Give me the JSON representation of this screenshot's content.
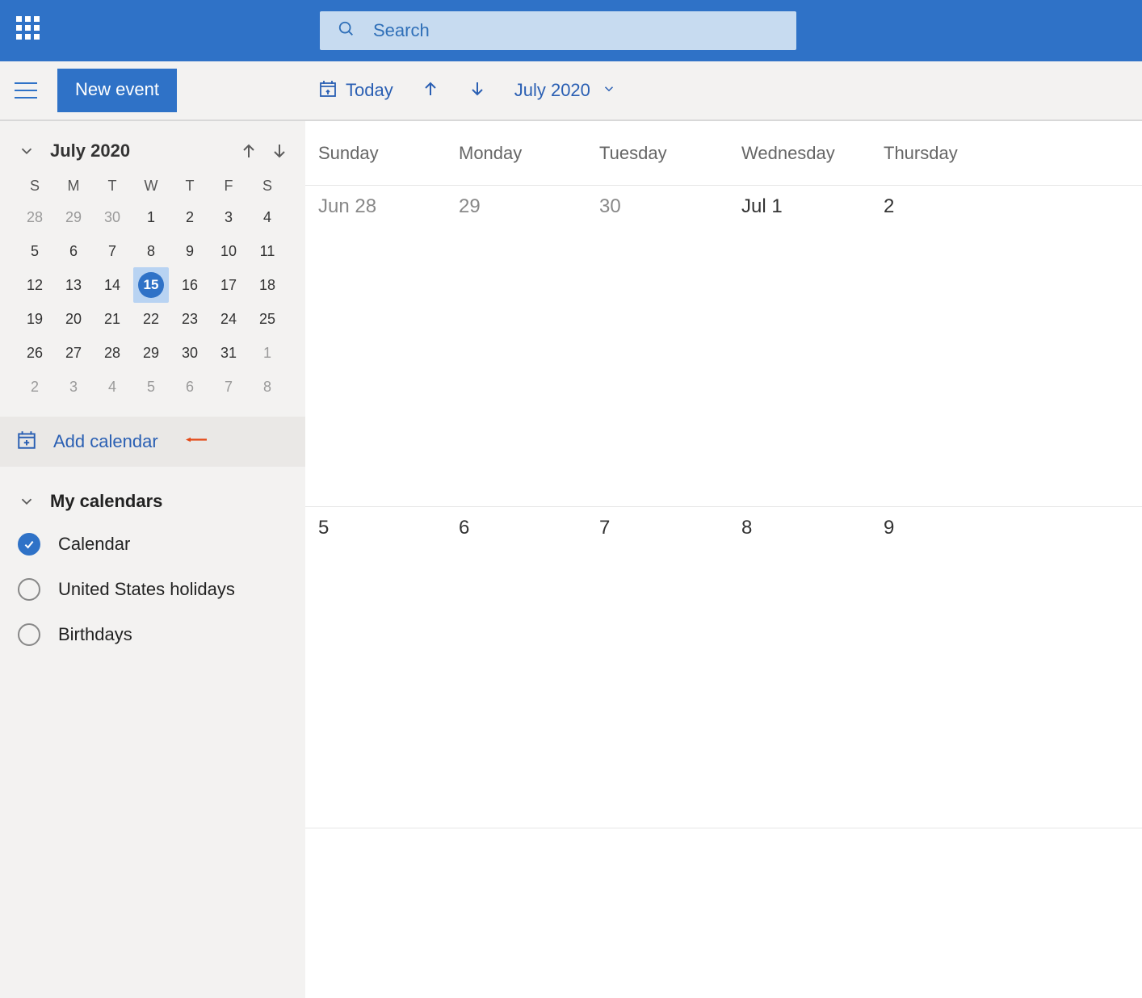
{
  "topbar": {
    "search_placeholder": "Search"
  },
  "subheader": {
    "new_event_label": "New event",
    "today_label": "Today",
    "month_label": "July 2020"
  },
  "mini_calendar": {
    "title": "July 2020",
    "weekday_initials": [
      "S",
      "M",
      "T",
      "W",
      "T",
      "F",
      "S"
    ],
    "weeks": [
      [
        {
          "d": "28",
          "dim": true
        },
        {
          "d": "29",
          "dim": true
        },
        {
          "d": "30",
          "dim": true
        },
        {
          "d": "1"
        },
        {
          "d": "2"
        },
        {
          "d": "3"
        },
        {
          "d": "4"
        }
      ],
      [
        {
          "d": "5"
        },
        {
          "d": "6"
        },
        {
          "d": "7"
        },
        {
          "d": "8"
        },
        {
          "d": "9"
        },
        {
          "d": "10"
        },
        {
          "d": "11"
        }
      ],
      [
        {
          "d": "12"
        },
        {
          "d": "13"
        },
        {
          "d": "14"
        },
        {
          "d": "15",
          "today": true
        },
        {
          "d": "16"
        },
        {
          "d": "17"
        },
        {
          "d": "18"
        }
      ],
      [
        {
          "d": "19"
        },
        {
          "d": "20"
        },
        {
          "d": "21"
        },
        {
          "d": "22"
        },
        {
          "d": "23"
        },
        {
          "d": "24"
        },
        {
          "d": "25"
        }
      ],
      [
        {
          "d": "26"
        },
        {
          "d": "27"
        },
        {
          "d": "28"
        },
        {
          "d": "29"
        },
        {
          "d": "30"
        },
        {
          "d": "31"
        },
        {
          "d": "1",
          "dim": true
        }
      ],
      [
        {
          "d": "2",
          "dim": true
        },
        {
          "d": "3",
          "dim": true
        },
        {
          "d": "4",
          "dim": true
        },
        {
          "d": "5",
          "dim": true
        },
        {
          "d": "6",
          "dim": true
        },
        {
          "d": "7",
          "dim": true
        },
        {
          "d": "8",
          "dim": true
        }
      ]
    ]
  },
  "add_calendar_label": "Add calendar",
  "my_calendars": {
    "header": "My calendars",
    "items": [
      {
        "label": "Calendar",
        "checked": true,
        "color": "#2f72c7"
      },
      {
        "label": "United States holidays",
        "checked": false
      },
      {
        "label": "Birthdays",
        "checked": false
      }
    ]
  },
  "main_calendar": {
    "weekday_labels": [
      "Sunday",
      "Monday",
      "Tuesday",
      "Wednesday",
      "Thursday"
    ],
    "rows": [
      [
        {
          "d": "Jun 28",
          "dim": true
        },
        {
          "d": "29",
          "dim": true
        },
        {
          "d": "30",
          "dim": true
        },
        {
          "d": "Jul 1"
        },
        {
          "d": "2"
        }
      ],
      [
        {
          "d": "5"
        },
        {
          "d": "6"
        },
        {
          "d": "7"
        },
        {
          "d": "8"
        },
        {
          "d": "9"
        }
      ]
    ]
  },
  "colors": {
    "brand_blue": "#2f72c7",
    "annotation_orange": "#e44a18"
  }
}
